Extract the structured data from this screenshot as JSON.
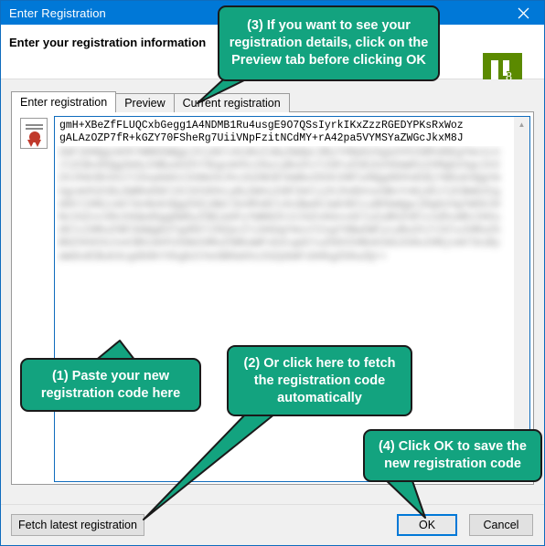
{
  "window": {
    "title": "Enter Registration",
    "close_icon": "close-icon"
  },
  "header": {
    "title": "Enter your registration information",
    "logo": {
      "icon": "app-logo-icon",
      "number": "8",
      "color": "#5b8a00"
    }
  },
  "tabs": [
    {
      "label": "Enter registration",
      "active": true
    },
    {
      "label": "Preview",
      "active": false
    },
    {
      "label": "Current registration",
      "active": false
    }
  ],
  "registration": {
    "icon": "certificate-icon",
    "code_line1": "gmH+XBeZfFLUQCxbGegg1A4NDMB1Ru4usgE9O7QSsIyrkIKxZzzRGEDYPKsRxWoz",
    "code_line2": "gALAzOZP7fR+kGZY70FSheRg7UiiVNpFzitNCdMY+rA42pa5VYMSYaZWGcJkxM8J",
    "redacted_text": "ZmF1bHQgcmVkYWN0ZWQgc2VjdGlvbiBvZiByZWdpc3RyYXRpb24ga2V5IGRhdGEgYmx1cnJlZCBvdXQgZm9yIHByaXZhY3kgcmVhc29ucyBoZXJlIGFuZCBjb250aW51ZXMgb24gc2V2ZXJhbCBtb3JlIGxpbmVzIG9mIGJhc2U2NCBlbmNvZGVkIHRleHQgdGhhdCBjYW5ub3QgYmUgcmVhZCBiZWNhdXNlIGl0IGhhcyBiZWVuIGRlbGliZXJhdGVseSBvYnNjdXJlZCBmb3IgdGhlIHNjcmVlbnNob3QgZG9jdW1lbnRhdGlvbiBwdXJwb3NlcyBhbmQgc28gb24gYW5kIHNvIGZvcnRoIHdpdGggbW9yZSBjaGFyYWN0ZXJzIGZvbGxvd2luZyBhZnRlcndhcmRzIHVudGlsIHRoZSBlbmQgb2YgdGhlIHZpc2libGUgYmxvY2sgYXBwZWFycyBoZXJlIGluIHRoZSB0ZXh0IGJveCBhcmVhIG9mIHRoZSBkaWFsb2cgd2luZG93IHNob3duIG9uIHNjcmVlbiByaWdodCBub3cgdG9kYXkgb2theSB0aGVuIGZpbmFsbHkgZG9uZQ==",
    "scroll_up_icon": "chevron-up-icon",
    "scroll_down_icon": "chevron-down-icon"
  },
  "footer": {
    "fetch_label": "Fetch latest registration",
    "ok_label": "OK",
    "cancel_label": "Cancel"
  },
  "callouts": {
    "one": "(1) Paste your new registration code here",
    "two": "(2) Or click here to fetch the registration code automatically",
    "three": "(3) If you want to see your registration details, click on the Preview tab before clicking OK",
    "four": "(4) Click OK to save the new registration code",
    "color": "#13a37f"
  }
}
